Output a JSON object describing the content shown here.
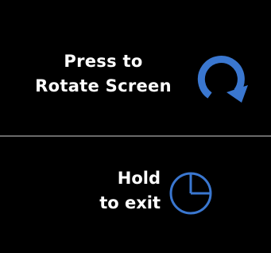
{
  "rotate": {
    "line1": "Press to",
    "line2": "Rotate Screen",
    "icon": "rotate-clockwise-icon"
  },
  "exit": {
    "line1": "Hold",
    "line2": "to exit",
    "icon": "clock-icon"
  },
  "colors": {
    "background": "#000000",
    "text": "#ffffff",
    "accent": "#3a77d0",
    "divider": "#6a6a6a"
  }
}
